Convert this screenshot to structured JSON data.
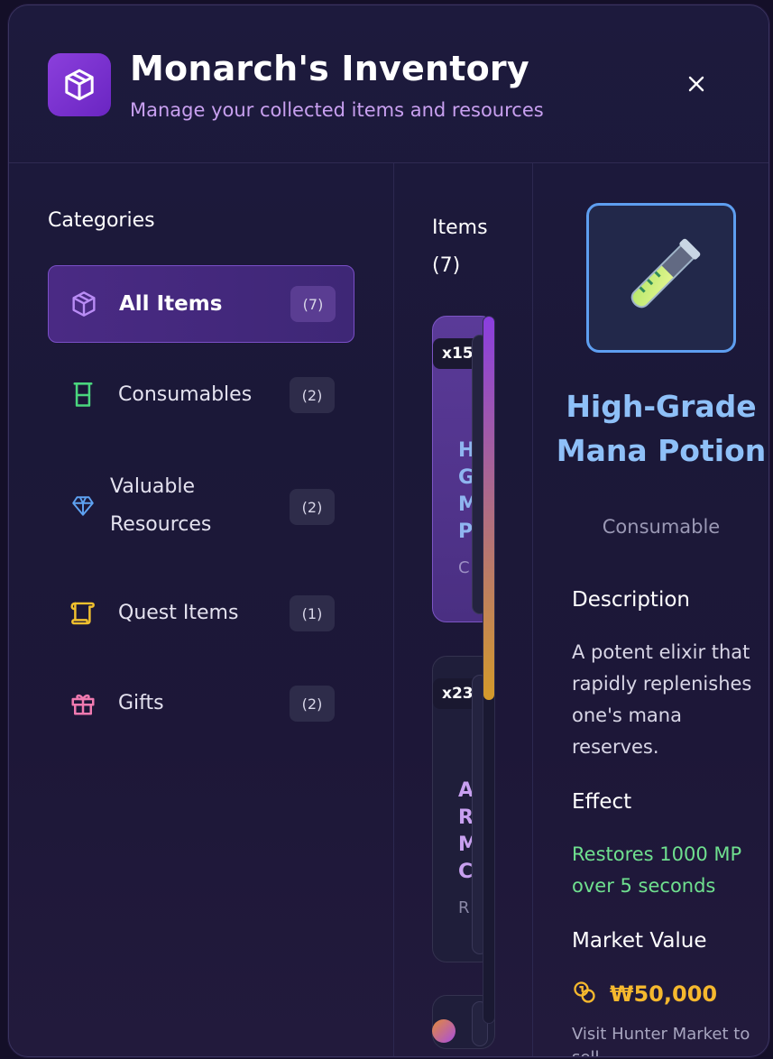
{
  "header": {
    "title": "Monarch's Inventory",
    "subtitle": "Manage your collected items and resources",
    "logo_icon": "cube-icon",
    "close_icon": "close-icon"
  },
  "categories": {
    "heading": "Categories",
    "items": [
      {
        "label": "All Items",
        "count": "(7)",
        "icon": "cube-icon",
        "active": true,
        "color": "#b98cf5"
      },
      {
        "label": "Consumables",
        "count": "(2)",
        "icon": "beaker-icon",
        "active": false,
        "color": "#4ad67e"
      },
      {
        "label": "Valuable Resources",
        "count": "(2)",
        "icon": "gem-icon",
        "active": false,
        "color": "#5ea2f2"
      },
      {
        "label": "Quest Items",
        "count": "(1)",
        "icon": "scroll-icon",
        "active": false,
        "color": "#f2c12e"
      },
      {
        "label": "Gifts",
        "count": "(2)",
        "icon": "gift-icon",
        "active": false,
        "color": "#f07ab0"
      }
    ]
  },
  "items_panel": {
    "heading": "Items (7)",
    "cards": [
      {
        "quantity": "x15",
        "visible_letters": [
          "H",
          "G",
          "M",
          "P"
        ],
        "type_letter": "C",
        "selected": true
      },
      {
        "quantity": "x23",
        "visible_letters": [
          "A",
          "R",
          "M",
          "C"
        ],
        "type_letter": "R",
        "selected": false
      }
    ]
  },
  "detail": {
    "icon": "test-tube-icon",
    "name": "High-Grade Mana Potion",
    "type": "Consumable",
    "description_heading": "Description",
    "description": "A potent elixir that rapidly replenishes one's mana reserves.",
    "effect_heading": "Effect",
    "effect": "Restores 1000 MP over 5 seconds",
    "market_heading": "Market Value",
    "market_value": "₩50,000",
    "sell_note": "Visit Hunter Market to sell",
    "coin_icon": "coins-icon"
  },
  "colors": {
    "accent": "#8b3fdc",
    "detail_name": "#8ec0f8",
    "effect": "#6fe08f",
    "value": "#f5b82e"
  }
}
